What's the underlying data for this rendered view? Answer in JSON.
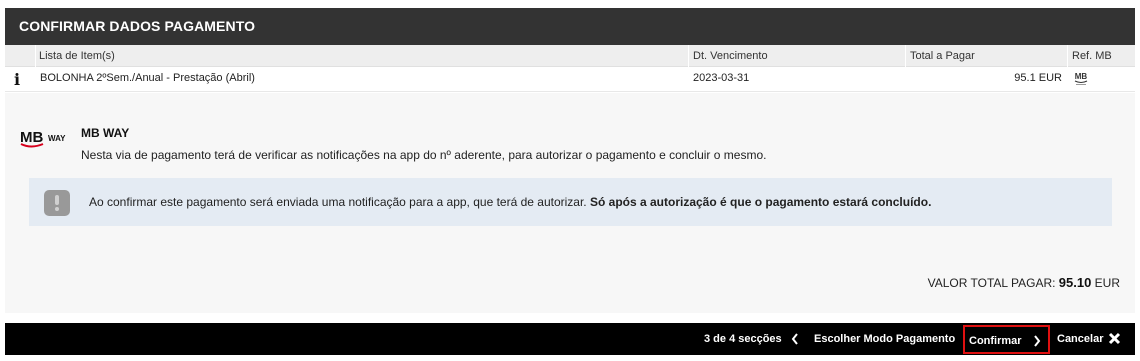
{
  "header": {
    "title": "CONFIRMAR DADOS PAGAMENTO"
  },
  "table": {
    "columns": [
      "Lista de Item(s)",
      "Dt. Vencimento",
      "Total a Pagar",
      "Ref. MB"
    ],
    "rows": [
      {
        "info_icon": "i",
        "item": "BOLONHA 2ºSem./Anual - Prestação (Abril)",
        "due_date": "2023-03-31",
        "total": "95.1 EUR",
        "ref_icon": "mb-reference-icon"
      }
    ]
  },
  "payment_method": {
    "logo_text": "WAY",
    "title": "MB WAY",
    "description": "Nesta via de pagamento terá de verificar as notificações na app do nº aderente, para autorizar o pagamento e concluir o mesmo."
  },
  "notice": {
    "text": "Ao confirmar este pagamento será enviada uma notificação para a app, que terá de autorizar. ",
    "bold_text": "Só após a autorização é que o pagamento estará concluído."
  },
  "total": {
    "label": "VALOR TOTAL PAGAR: ",
    "amount": "95.10",
    "currency": " EUR"
  },
  "footer": {
    "progress": "3 de 4 secções",
    "back_label": "Escolher Modo Pagamento",
    "confirm_label": "Confirmar",
    "cancel_label": "Cancelar"
  },
  "colors": {
    "header_bg": "#333333",
    "footer_bg": "#000000",
    "highlight": "#e01010",
    "notice_bg": "#e4ebf3",
    "mbway_red": "#d6001c"
  }
}
